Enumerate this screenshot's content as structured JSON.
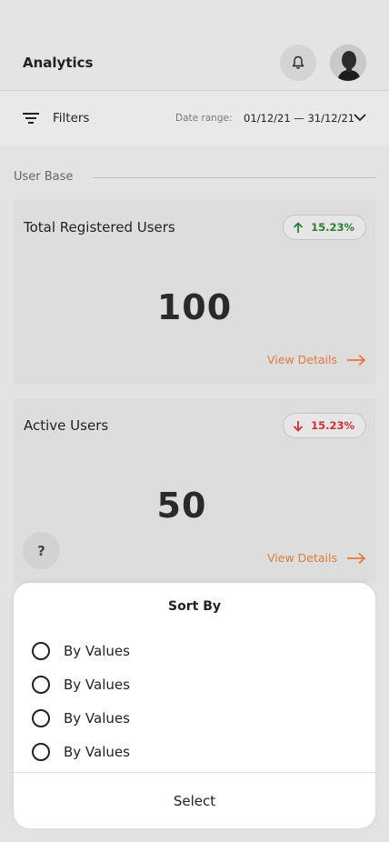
{
  "header": {
    "title": "Analytics",
    "bell_icon": "bell-icon",
    "avatar_icon": "user-avatar"
  },
  "filters": {
    "label": "Filters",
    "date_range_label": "Date range:",
    "date_range_value": "01/12/21 — 31/12/21"
  },
  "section": {
    "label": "User Base"
  },
  "cards": [
    {
      "title": "Total Registered Users",
      "value": "100",
      "change": "15.23%",
      "direction": "up",
      "change_color": "#2e7d32",
      "link": "View Details"
    },
    {
      "title": "Active Users",
      "value": "50",
      "change": "15.23%",
      "direction": "down",
      "change_color": "#d32f2f",
      "link": "View Details"
    }
  ],
  "help": {
    "label": "?"
  },
  "sort_sheet": {
    "title": "Sort By",
    "options": [
      {
        "label": "By Values",
        "selected": false
      },
      {
        "label": "By Values",
        "selected": false
      },
      {
        "label": "By Values",
        "selected": false
      },
      {
        "label": "By Values",
        "selected": false
      }
    ],
    "select_label": "Select"
  },
  "colors": {
    "accent": "#e07a3e",
    "positive": "#2e7d32",
    "negative": "#d32f2f"
  }
}
